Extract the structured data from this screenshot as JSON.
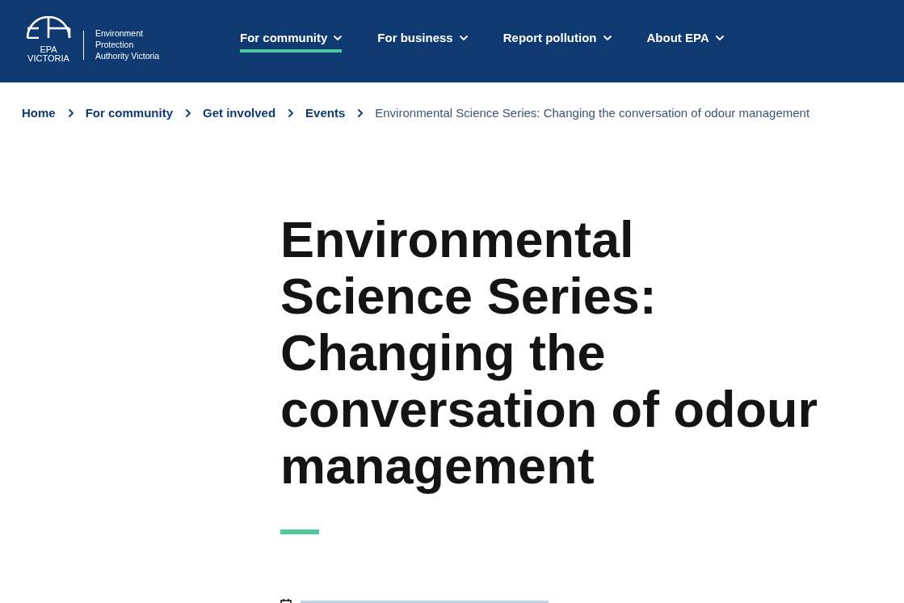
{
  "header": {
    "logo": {
      "acronym": "EPA",
      "state": "VICTORIA",
      "full_name": [
        "Environment",
        "Protection",
        "Authority Victoria"
      ]
    },
    "nav": [
      {
        "label": "For community",
        "selected": true
      },
      {
        "label": "For business",
        "selected": false
      },
      {
        "label": "Report pollution",
        "selected": false
      },
      {
        "label": "About EPA",
        "selected": false
      }
    ]
  },
  "breadcrumb": {
    "links": [
      "Home",
      "For community",
      "Get involved",
      "Events"
    ],
    "current": "Environmental Science Series: Changing the conversation of odour management"
  },
  "page_title": "Environmental Science Series: Changing the conversation of odour management"
}
